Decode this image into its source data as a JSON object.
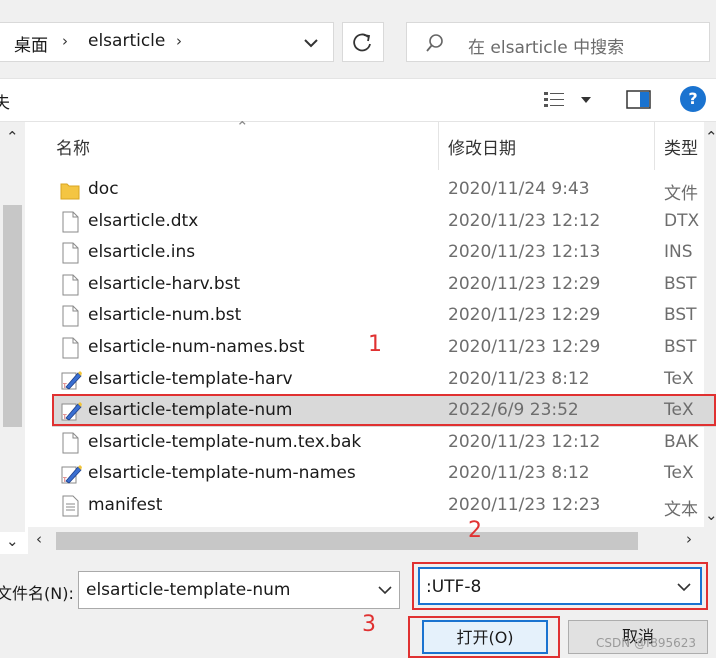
{
  "address": {
    "root": "桌面",
    "folder": "elsarticle",
    "separator": "›"
  },
  "search": {
    "placeholder": "在 elsarticle 中搜索"
  },
  "toolbar": {
    "left_fragment": "夫"
  },
  "columns": {
    "name": "名称",
    "date": "修改日期",
    "type": "类型"
  },
  "files": [
    {
      "name": "doc",
      "date": "2020/11/24 9:43",
      "type": "文件",
      "icon": "folder-icon"
    },
    {
      "name": "elsarticle.dtx",
      "date": "2020/11/23 12:12",
      "type": "DTX",
      "icon": "document-icon"
    },
    {
      "name": "elsarticle.ins",
      "date": "2020/11/23 12:13",
      "type": "INS",
      "icon": "document-icon"
    },
    {
      "name": "elsarticle-harv.bst",
      "date": "2020/11/23 12:29",
      "type": "BST",
      "icon": "document-icon"
    },
    {
      "name": "elsarticle-num.bst",
      "date": "2020/11/23 12:29",
      "type": "BST",
      "icon": "document-icon"
    },
    {
      "name": "elsarticle-num-names.bst",
      "date": "2020/11/23 12:29",
      "type": "BST",
      "icon": "document-icon"
    },
    {
      "name": "elsarticle-template-harv",
      "date": "2020/11/23 8:12",
      "type": "TeX",
      "icon": "tex-file-icon"
    },
    {
      "name": "elsarticle-template-num",
      "date": "2022/6/9 23:52",
      "type": "TeX",
      "icon": "tex-file-icon",
      "selected": true
    },
    {
      "name": "elsarticle-template-num.tex.bak",
      "date": "2020/11/23 12:12",
      "type": "BAK",
      "icon": "document-icon"
    },
    {
      "name": "elsarticle-template-num-names",
      "date": "2020/11/23 8:12",
      "type": "TeX",
      "icon": "tex-file-icon"
    },
    {
      "name": "manifest",
      "date": "2020/11/23 12:23",
      "type": "文本",
      "icon": "text-file-icon"
    }
  ],
  "annotations": {
    "one": "1",
    "two": "2",
    "three": "3"
  },
  "filename": {
    "label": "文件名(N):",
    "value": "elsarticle-template-num"
  },
  "encoding": {
    "value": ":UTF-8"
  },
  "buttons": {
    "open": "打开(O)",
    "cancel": "取消"
  },
  "watermark": "CSDN @f895623",
  "colors": {
    "accent": "#1a73d0",
    "annotation": "#e03131",
    "selected_row": "#d9d9d9"
  }
}
